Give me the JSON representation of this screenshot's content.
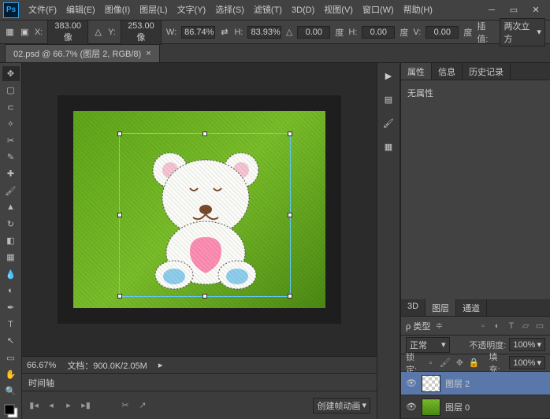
{
  "menu": [
    "文件(F)",
    "编辑(E)",
    "图像(I)",
    "图层(L)",
    "文字(Y)",
    "选择(S)",
    "滤镜(T)",
    "3D(D)",
    "视图(V)",
    "窗口(W)",
    "帮助(H)"
  ],
  "options": {
    "x_label": "X:",
    "x": "383.00 像",
    "y_label": "Y:",
    "y": "253.00 像",
    "w_label": "W:",
    "w": "86.74%",
    "h_label": "H:",
    "h": "83.93%",
    "angle_label": "△",
    "angle": "0.00",
    "skewh_label": "H:",
    "skewh": "0.00",
    "deg1": "度",
    "skewv_label": "V:",
    "skewv": "0.00",
    "deg2": "度",
    "interp_label": "插值:",
    "interp": "两次立方"
  },
  "doc": {
    "tab": "02.psd @ 66.7% (图层 2, RGB/8)"
  },
  "status": {
    "zoom": "66.67%",
    "docinfo": "文档：900.0K/2.05M"
  },
  "timeline": {
    "label": "时间轴",
    "button": "创建帧动画"
  },
  "panels": {
    "prop_tabs": [
      "属性",
      "信息",
      "历史记录"
    ],
    "no_props": "无属性",
    "layer_tabs": [
      "3D",
      "图层",
      "通道"
    ],
    "blend": "正常",
    "opacity_label": "不透明度:",
    "opacity": "100%",
    "lock_label": "锁定:",
    "fill_label": "填充:",
    "fill": "100%",
    "layers": [
      {
        "name": "图层 2"
      },
      {
        "name": "图层 0"
      }
    ],
    "kind_label": "ρ 类型"
  }
}
